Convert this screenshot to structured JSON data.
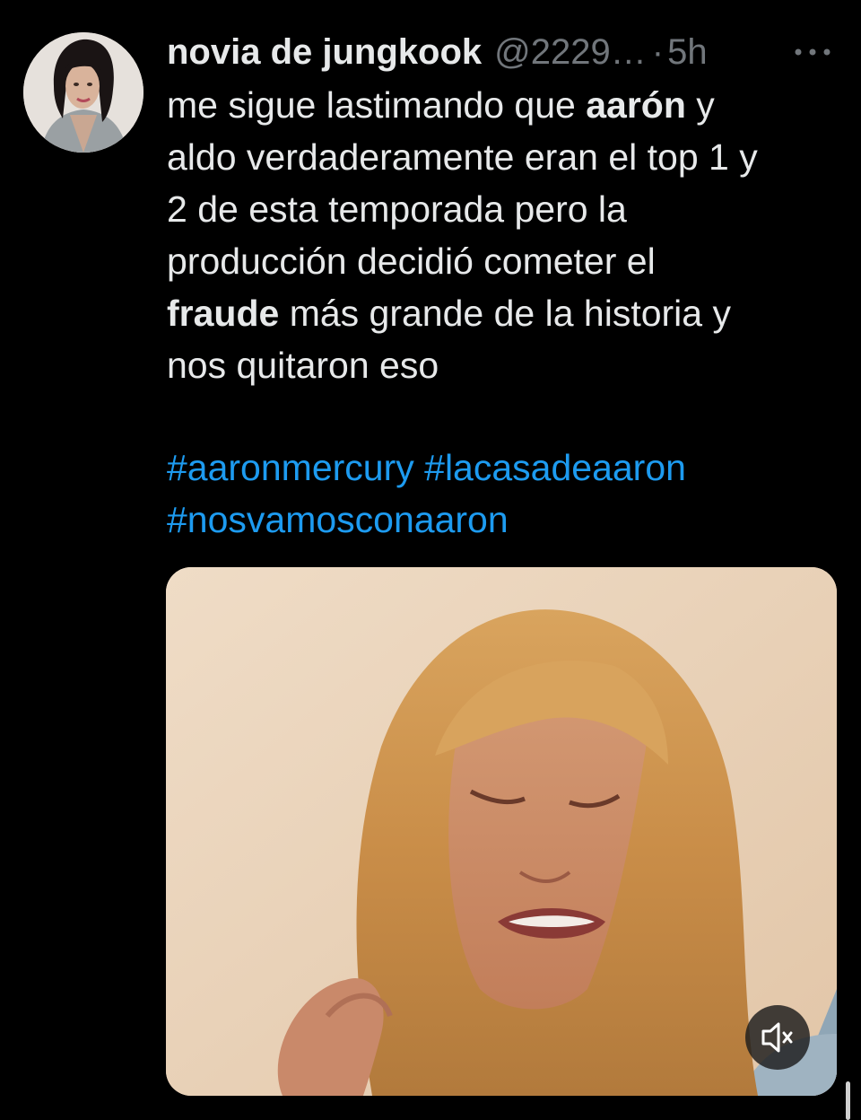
{
  "author": {
    "display_name": "novia de jungkook",
    "handle": "@2229…",
    "separator": "·",
    "timestamp": "5h",
    "avatar_icon": "profile-photo"
  },
  "more_icon": "more-horizontal-icon",
  "tweet": {
    "line1_pre": "me sigue lastimando que ",
    "line1_bold": "aarón",
    "line1_post": " y",
    "line2": "aldo verdaderamente eran el top 1 y",
    "line3": "2 de esta temporada pero la",
    "line4": "producción decidió cometer el",
    "line5_bold": "fraude",
    "line5_post": " más grande de la historia y",
    "line6": "nos quitaron eso"
  },
  "hashtags": [
    "#aaronmercury",
    "#lacasadeaaron",
    "#nosvamosconaaron"
  ],
  "media": {
    "type": "video",
    "mute_icon": "volume-muted-icon"
  },
  "colors": {
    "background": "#000000",
    "text": "#e7e9ea",
    "secondary": "#71767b",
    "link": "#1d9bf0"
  }
}
